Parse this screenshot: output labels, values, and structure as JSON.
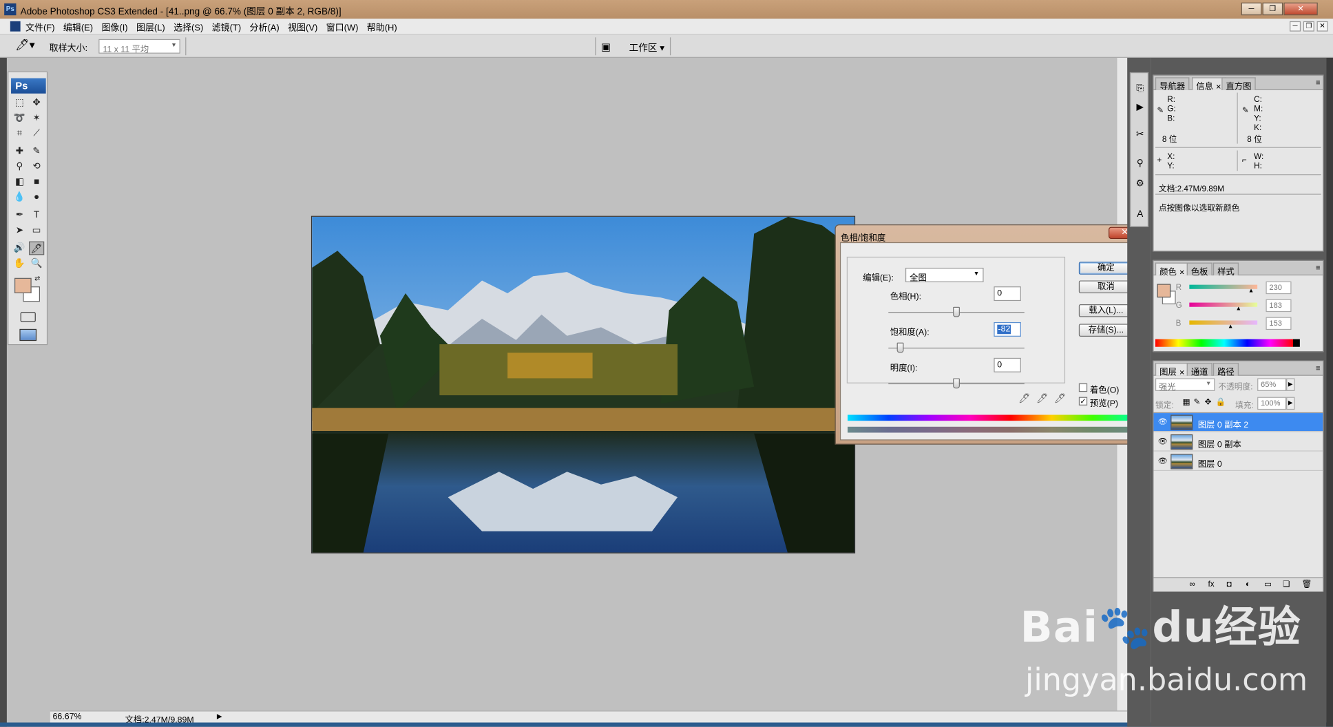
{
  "window": {
    "title": "Adobe Photoshop CS3 Extended - [41..png @ 66.7% (图层 0 副本 2, RGB/8)]",
    "controls": [
      "─",
      "❐",
      "✕"
    ]
  },
  "menubar": {
    "items": [
      "文件(F)",
      "编辑(E)",
      "图像(I)",
      "图层(L)",
      "选择(S)",
      "滤镜(T)",
      "分析(A)",
      "视图(V)",
      "窗口(W)",
      "帮助(H)"
    ]
  },
  "options": {
    "sample_label": "取样大小:",
    "sample_value": "11 x 11 平均",
    "workspace": "工作区 ▾"
  },
  "status": {
    "zoom": "66.67%",
    "doc": "文档:2.47M/9.89M"
  },
  "dialog": {
    "title": "色相/饱和度",
    "close": "✕",
    "edit_label": "编辑(E):",
    "edit_value": "全图",
    "hue_label": "色相(H):",
    "hue_value": "0",
    "sat_label": "饱和度(A):",
    "sat_value": "-82",
    "light_label": "明度(I):",
    "light_value": "0",
    "ok": "确定",
    "cancel": "取消",
    "load": "载入(L)...",
    "save": "存储(S)...",
    "colorize": "着色(O)",
    "preview": "预览(P)",
    "preview_checked": "✓",
    "sliders": {
      "hue": 0,
      "saturation": -82,
      "lightness": 0
    }
  },
  "info_panel": {
    "tabs": [
      "导航器",
      "信息",
      "直方图"
    ],
    "r": "R:",
    "g": "G:",
    "b": "B:",
    "c": "C:",
    "m": "M:",
    "y": "Y:",
    "k": "K:",
    "bits_left": "8 位",
    "bits_right": "8 位",
    "x": "X:",
    "y2": "Y:",
    "w": "W:",
    "h": "H:",
    "doc": "文档:2.47M/9.89M",
    "hint": "点按图像以选取新颜色"
  },
  "color_panel": {
    "tabs": [
      "颜色",
      "色板",
      "样式"
    ],
    "r_label": "R",
    "g_label": "G",
    "b_label": "B",
    "r": "230",
    "g": "183",
    "b": "153",
    "fg_color": "#e6b799"
  },
  "layers_panel": {
    "tabs": [
      "图层",
      "通道",
      "路径"
    ],
    "blend": "强光",
    "opacity_label": "不透明度:",
    "opacity": "65%",
    "lock_label": "锁定:",
    "fill_label": "填充:",
    "fill": "100%",
    "layers": [
      "图层 0 副本 2",
      "图层 0 副本",
      "图层 0"
    ]
  },
  "watermark": {
    "brand": "Bai🐾du经验",
    "url": "jingyan.baidu.com"
  }
}
